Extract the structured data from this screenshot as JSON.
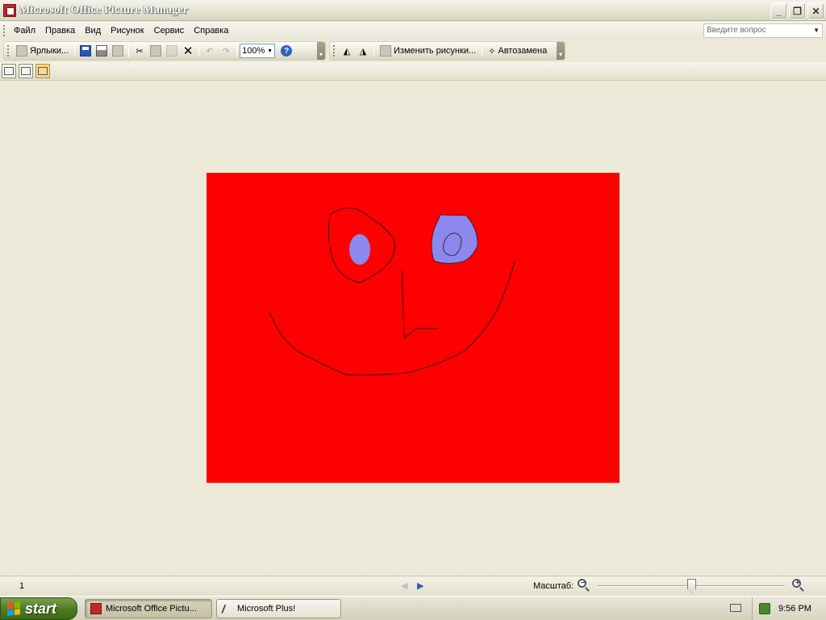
{
  "window": {
    "title": "Microsoft Office Picture Manager",
    "buttons": [
      "minimize",
      "restore",
      "close"
    ]
  },
  "menu": {
    "items": [
      "Файл",
      "Правка",
      "Вид",
      "Рисунок",
      "Сервис",
      "Справка"
    ],
    "help_placeholder": "Введите вопрос"
  },
  "toolbar": {
    "shortcuts_label": "Ярлыки...",
    "zoom_value": "100%",
    "edit_pictures_label": "Изменить рисунки...",
    "autocorrect_label": "Автозамена"
  },
  "status": {
    "page_number": "1",
    "zoom_label": "Масштаб:",
    "zoom_slider_fraction": 0.5
  },
  "taskbar": {
    "start_label": "start",
    "tasks": [
      "Microsoft Office Pictu...",
      "Microsoft Plus!"
    ],
    "clock": "9:56 PM"
  },
  "colors": {
    "picture_background": "#ff0000",
    "eye_fill": "#8b88ee",
    "line": "#3a0a0a"
  }
}
